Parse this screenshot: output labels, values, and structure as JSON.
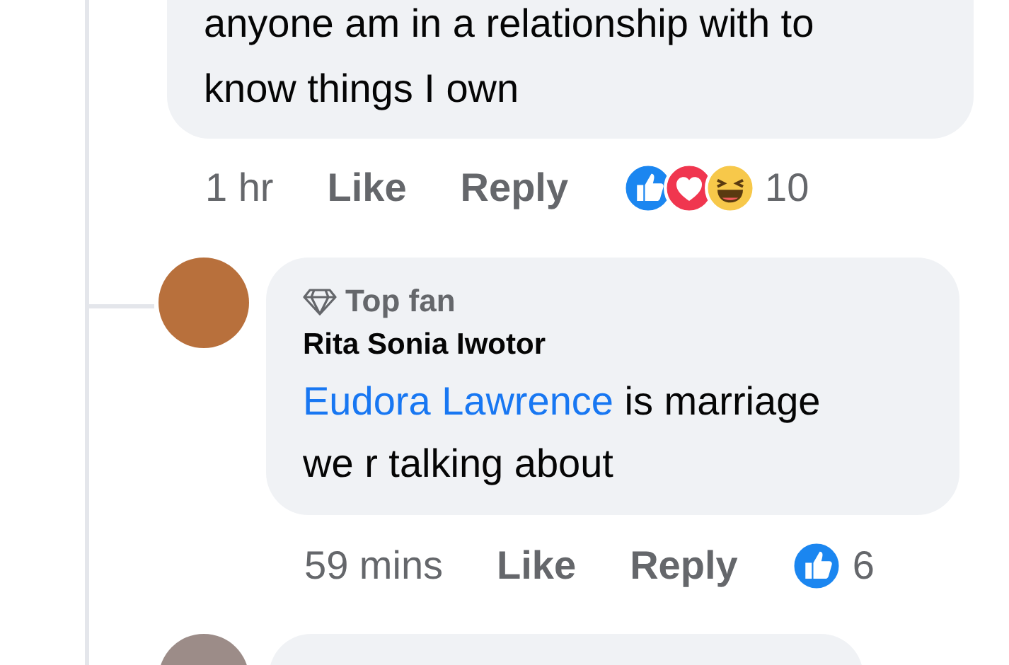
{
  "comment": {
    "lines": [
      "anyone am in a relationship with to",
      "know things I own"
    ],
    "time": "1 hr",
    "like": "Like",
    "reply": "Reply",
    "reactions": [
      {
        "kind": "like"
      },
      {
        "kind": "love"
      },
      {
        "kind": "haha"
      }
    ],
    "reaction_count": "10"
  },
  "reply": {
    "badge": "Top fan",
    "author": "Rita Sonia Iwotor",
    "mention": "Eudora Lawrence",
    "lines": [
      "is marriage",
      "we r talking about"
    ],
    "time": "59 mins",
    "like": "Like",
    "reply": "Reply",
    "reactions": [
      {
        "kind": "like"
      }
    ],
    "reaction_count": "6"
  }
}
